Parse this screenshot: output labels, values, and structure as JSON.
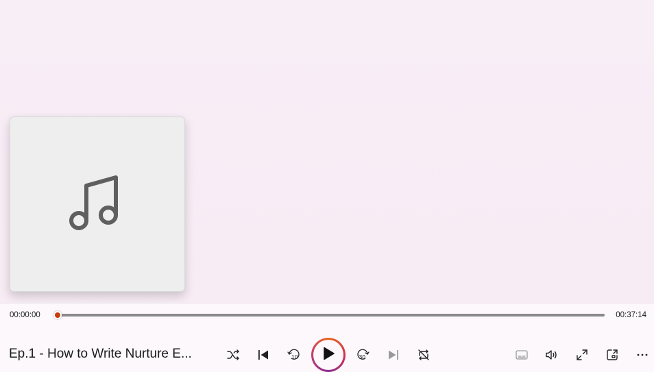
{
  "player": {
    "current_time": "00:00:00",
    "total_time": "00:37:14",
    "progress": 0.0,
    "episode_title": "Ep.1 - How to Write Nurture E...",
    "album_art_icon": "music-note-icon"
  },
  "controls": {
    "buttons": [
      "shuffle-icon",
      "previous-icon",
      "skip-back-10-icon",
      "play-icon",
      "skip-forward-30-icon",
      "next-icon",
      "repeat-icon",
      "captions-icon",
      "volume-icon",
      "fullscreen-icon",
      "mini-player-icon",
      "more-options-icon"
    ],
    "skip_back_label": "10",
    "skip_forward_label": "30"
  },
  "colors": {
    "accent": "#c63d0f",
    "background": "#f8edf5",
    "play_ring": [
      "#e9661f",
      "#d2324e",
      "#8a2e8e"
    ]
  }
}
